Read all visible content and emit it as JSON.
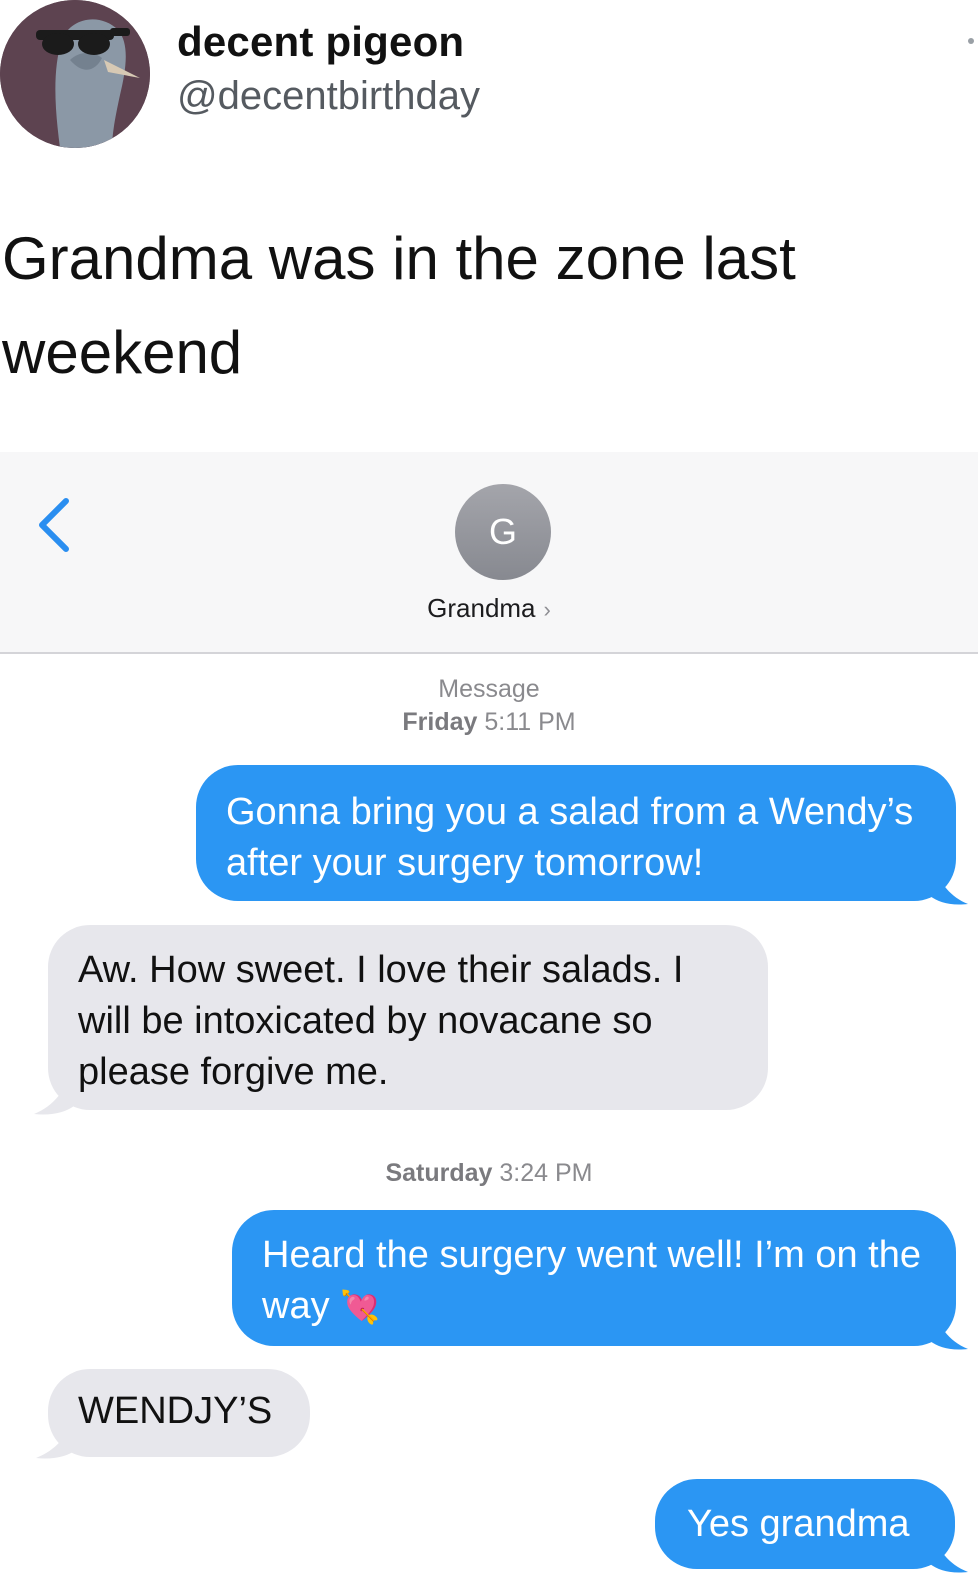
{
  "tweet": {
    "display_name": "decent pigeon",
    "handle": "@decentbirthday",
    "text": "Grandma was in the zone last weekend"
  },
  "conversation": {
    "contact_initial": "G",
    "contact_name": "Grandma",
    "service_label": "Message",
    "messages_group_1_timestamp_day": "Friday",
    "messages_group_1_timestamp_time": "5:11 PM",
    "messages_group_2_timestamp_day": "Saturday",
    "messages_group_2_timestamp_time": "3:24 PM",
    "messages": [
      {
        "direction": "sent",
        "text": "Gonna bring you a salad from a Wendy’s after your surgery tomorrow!"
      },
      {
        "direction": "received",
        "text": "Aw. How sweet. I love their salads. I will be intoxicated by novacane so please forgive me."
      },
      {
        "direction": "sent",
        "text": "Heard the surgery went well! I’m on the way",
        "emoji": "💘"
      },
      {
        "direction": "received",
        "text": "WENDJY’S"
      },
      {
        "direction": "sent",
        "text": "Yes grandma"
      }
    ]
  },
  "colors": {
    "sent_bubble": "#2b96f3",
    "received_bubble": "#e7e7ec",
    "ios_blue": "#2a8ef0"
  }
}
